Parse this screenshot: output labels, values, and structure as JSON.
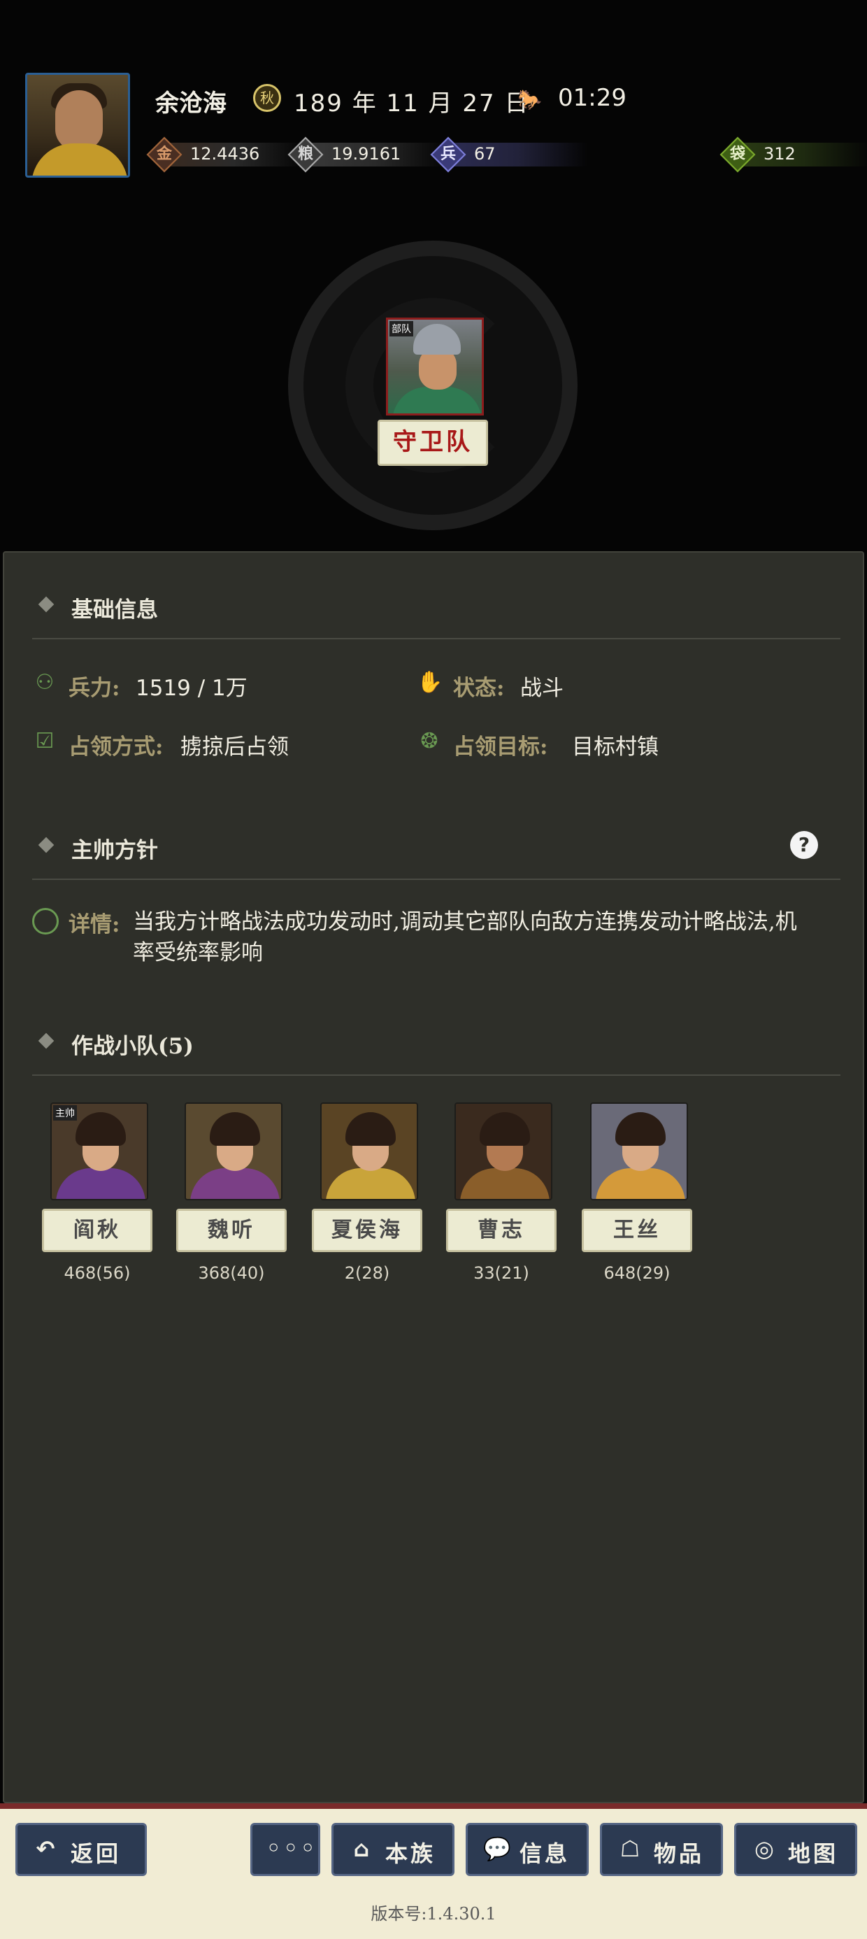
{
  "header": {
    "player_name": "余沧海",
    "season_icon": "season-icon",
    "season_glyph": "秋",
    "date": "189 年 11 月 27 日",
    "time": "01:29",
    "stats": [
      {
        "icon": "coin-icon",
        "glyph": "金",
        "value": "12.4436",
        "color": "#a0643a"
      },
      {
        "icon": "grain-icon",
        "glyph": "粮",
        "value": "19.9161",
        "color": "#9a9a9a"
      },
      {
        "icon": "soldier-icon",
        "glyph": "兵",
        "value": "67",
        "color": "#5b5cae"
      },
      {
        "icon": "money-bag-icon",
        "glyph": "袋",
        "value": "312",
        "color": "#5d8a20"
      }
    ]
  },
  "troop": {
    "tag": "部队",
    "name": "守卫队"
  },
  "basic_info": {
    "title": "基础信息",
    "troops_label": "兵力:",
    "troops_value": "1519 / 1万",
    "status_label": "状态:",
    "status_value": "战斗",
    "occupy_mode_label": "占领方式:",
    "occupy_mode_value": "掳掠后占领",
    "occupy_target_label": "占领目标:",
    "occupy_target_value": "目标村镇"
  },
  "policy": {
    "title": "主帅方针",
    "help": "?",
    "detail_label": "详情:",
    "detail_text": "当我方计略战法成功发动时,调动其它部队向敌方连携发动计略战法,机率受统率影响"
  },
  "squad": {
    "title": "作战小队(5)",
    "leader_tag": "主帅",
    "generals": [
      {
        "name": "阎秋",
        "stats": "468(56)",
        "robe": "#6a3a8c",
        "bg": "#4a3a2a"
      },
      {
        "name": "魏听",
        "stats": "368(40)",
        "robe": "#7b3f86",
        "bg": "#5a4a30"
      },
      {
        "name": "夏侯海",
        "stats": "2(28)",
        "robe": "#c9a43a",
        "bg": "#5a4424"
      },
      {
        "name": "曹志",
        "stats": "33(21)",
        "robe": "#8a5e2a",
        "bg": "#3a2a1e"
      },
      {
        "name": "王丝",
        "stats": "648(29)",
        "robe": "#d49a3a",
        "bg": "#6a6a78"
      }
    ]
  },
  "bottom_nav": {
    "back": "返回",
    "more": "◦◦◦",
    "clan": "本族",
    "info": "信息",
    "items": "物品",
    "map": "地图"
  },
  "version": "版本号:1.4.30.1"
}
